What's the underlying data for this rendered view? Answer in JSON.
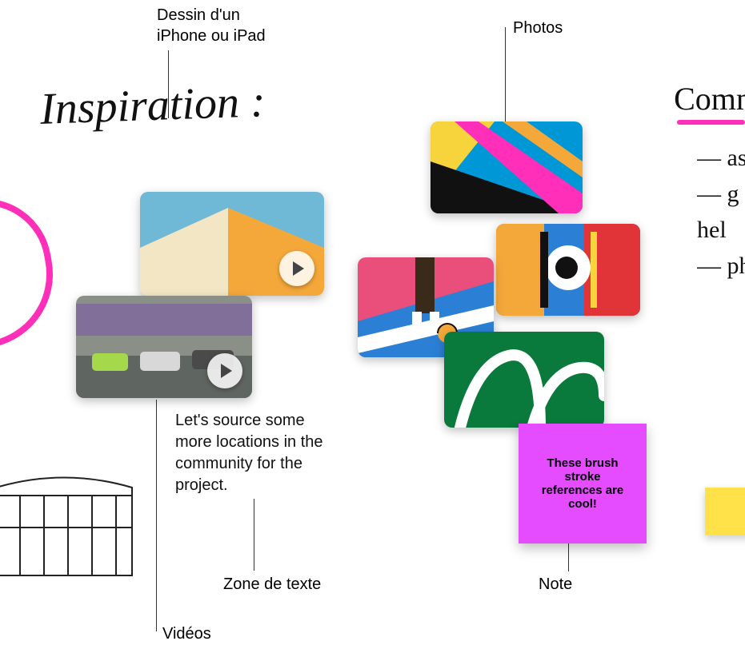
{
  "callouts": {
    "drawing": "Dessin d'un\niPhone ou iPad",
    "photos": "Photos",
    "videos": "Vidéos",
    "textzone": "Zone de texte",
    "note": "Note"
  },
  "handwriting": {
    "title": "Inspiration :",
    "listTitle": "Comm",
    "listItems": "— as\n— g\nhel\n— ph"
  },
  "textBlock": "Let's source some more locations in the community for the project.",
  "stickyNote": "These brush stroke references are cool!"
}
